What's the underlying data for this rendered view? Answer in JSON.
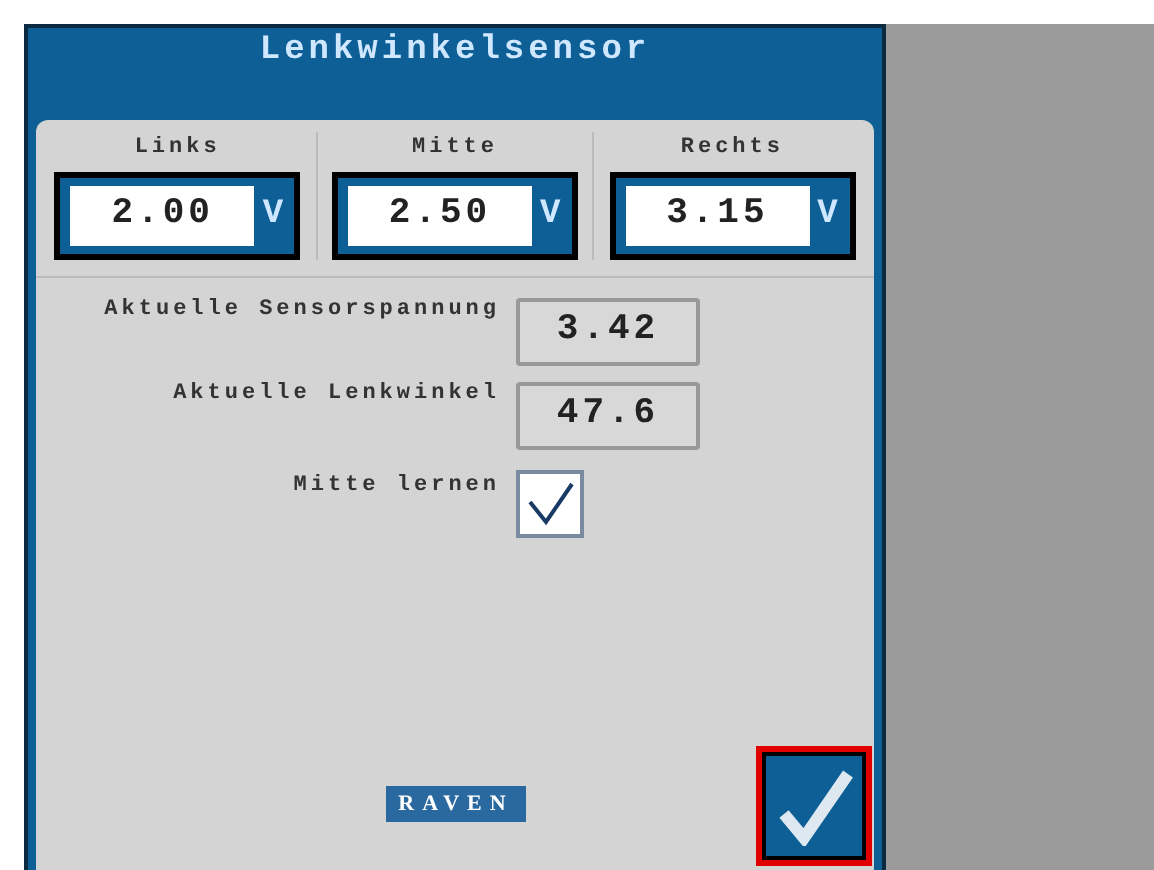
{
  "title": "Lenkwinkelsensor",
  "voltages": [
    {
      "label": "Links",
      "value": "2.00",
      "unit": "V"
    },
    {
      "label": "Mitte",
      "value": "2.50",
      "unit": "V"
    },
    {
      "label": "Rechts",
      "value": "3.15",
      "unit": "V"
    }
  ],
  "readouts": [
    {
      "label": "Aktuelle Sensorspannung",
      "value": "3.42"
    },
    {
      "label": "Aktuelle Lenkwinkel",
      "value": "47.6"
    }
  ],
  "learn_center": {
    "label": "Mitte lernen",
    "checked": true
  },
  "logo": "RAVEN",
  "confirm_button": {
    "highlighted": true
  }
}
